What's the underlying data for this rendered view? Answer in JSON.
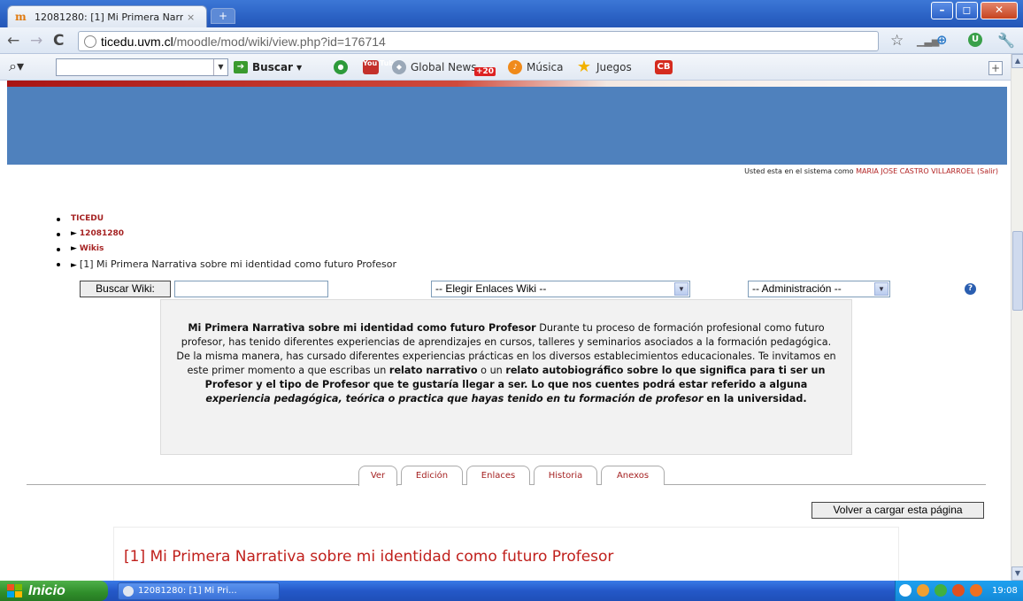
{
  "browser": {
    "tab_title": "12081280: [1] Mi Primera Narr",
    "tab_close": "×",
    "new_tab": "+",
    "url_host": "ticedu.uvm.cl",
    "url_path": "/moodle/mod/wiki/view.php?id=176714",
    "window_buttons": {
      "minimize": "–",
      "maximize": "◻",
      "close": "✕"
    }
  },
  "toolbar": {
    "buscar_label": "Buscar",
    "global_news_label": "Global News",
    "global_news_badge": "+20",
    "musica_label": "Música",
    "juegos_label": "Juegos",
    "cb_label": "CB",
    "youtube_label": "You Tube"
  },
  "page": {
    "logged_in_prefix": "Usted esta en el sistema como",
    "user_name": "MARIA JOSE CASTRO VILLARROEL",
    "logout": "(Salir)",
    "breadcrumbs": [
      {
        "label": "TICEDU"
      },
      {
        "label": "12081280"
      },
      {
        "label": "Wikis"
      },
      {
        "label": "[1] Mi Primera Narrativa sobre mi identidad como futuro Profesor"
      }
    ],
    "search_button": "Buscar Wiki:",
    "search_value": "",
    "links_select": "-- Elegir Enlaces Wiki --",
    "admin_select": "-- Administración --",
    "summary": {
      "title": "Mi Primera Narrativa sobre mi identidad como futuro Profesor",
      "text_1": " Durante tu proceso de formación profesional como futuro profesor, has tenido diferentes experiencias de aprendizajes en cursos, talleres y seminarios asociados a la formación pedagógica. De la misma manera, has cursado diferentes experiencias prácticas en los diversos establecimientos educacionales. Te invitamos en este primer momento a que escribas un ",
      "bold_1": "relato narrativo",
      "text_2": " o un ",
      "bold_2": "relato autobiográfico sobre lo que significa para ti ser un Profesor y el tipo de Profesor que te gustaría llegar a ser. Lo que nos cuentes podrá estar referido a alguna ",
      "italic_1": "experiencia pedagógica, teórica o practica que hayas tenido en tu formación de profesor",
      "bold_3": " en la universidad."
    },
    "tabs": [
      "Ver",
      "Edición",
      "Enlaces",
      "Historia",
      "Anexos"
    ],
    "reload_button": "Volver a cargar esta página",
    "page_title": "[1] Mi Primera Narrativa sobre mi identidad como futuro Profesor"
  },
  "taskbar": {
    "start": "Inicio",
    "task_item": "12081280: [1] Mi Pri...",
    "clock": "19:08"
  }
}
